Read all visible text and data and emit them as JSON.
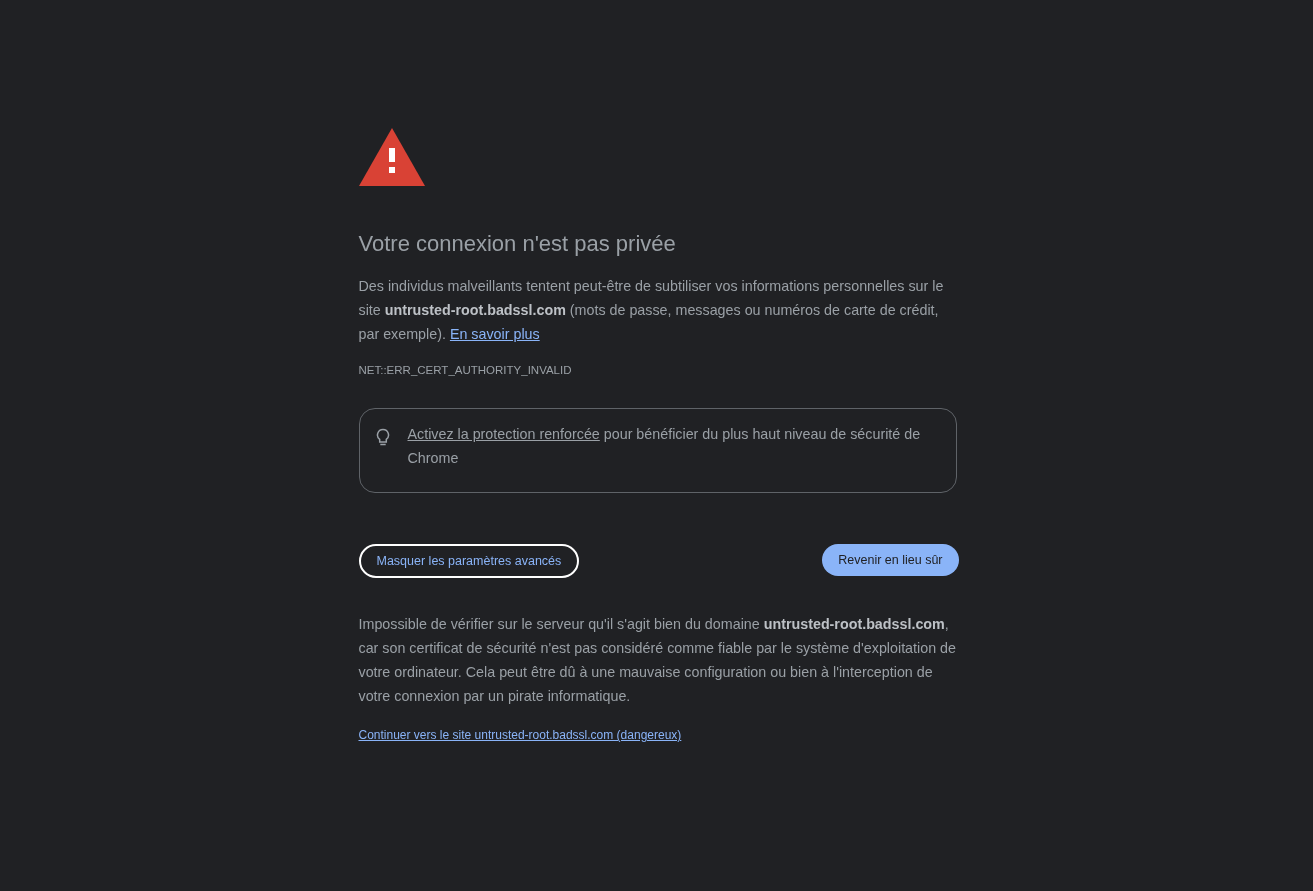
{
  "heading": "Votre connexion n'est pas privée",
  "intro": {
    "text": "Des individus malveillants tentent peut-être de subtiliser vos informations personnelles sur le site **untrusted-root.badssl.com** (mots de passe, messages ou numéros de carte de crédit, par exemple).",
    "link": "En savoir plus"
  },
  "error_code": "NET::ERR_CERT_AUTHORITY_INVALID",
  "tip": {
    "link": "Activez la protection renforcée",
    "text": "pour bénéficier du plus haut niveau de sécurité de Chrome"
  },
  "buttons": [
    {
      "label": "Masquer les paramètres avancés",
      "kind": "outline"
    },
    {
      "label": "Revenir en lieu sûr",
      "kind": "primary"
    }
  ],
  "details": "Impossible de vérifier sur le serveur qu'il s'agit bien du domaine **untrusted-root.badssl.com**, car son certificat de sécurité n'est pas considéré comme fiable par le système d'exploitation de votre ordinateur. Cela peut être dû à une mauvaise configuration ou bien à l'interception de votre connexion par un pirate informatique.",
  "proceed_link": "Continuer vers le site untrusted-root.badssl.com (dangereux)"
}
